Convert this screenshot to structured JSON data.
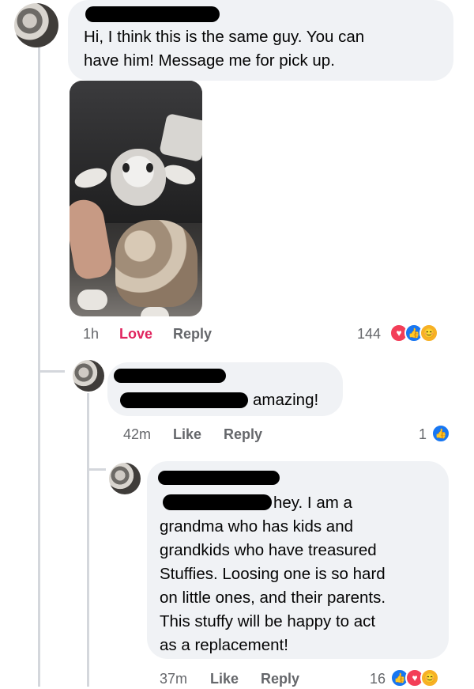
{
  "comment1": {
    "text_lines": [
      "Hi, I think this is the same guy. You can",
      "have him! Message me for pick up."
    ],
    "time": "1h",
    "action_love": "Love",
    "action_reply": "Reply",
    "reaction_count": "144",
    "reaction_icons": [
      "love-reaction",
      "like-reaction",
      "care-reaction"
    ]
  },
  "comment2": {
    "text_suffix": "amazing!",
    "time": "42m",
    "action_like": "Like",
    "action_reply": "Reply",
    "reaction_count": "1",
    "reaction_icons": [
      "like-reaction"
    ]
  },
  "comment3": {
    "line1_suffix": "hey. I am a",
    "text_lines": [
      "grandma who has kids and",
      "grandkids who have treasured",
      "Stuffies. Loosing one is so hard",
      "on little ones, and their parents.",
      "This stuffy will be happy to act",
      "as a replacement!"
    ],
    "time": "37m",
    "action_like": "Like",
    "action_reply": "Reply",
    "reaction_count": "16",
    "reaction_icons": [
      "like-reaction",
      "love-reaction",
      "care-reaction"
    ]
  },
  "colors": {
    "bubble": "#f0f2f5",
    "meta": "#65676b",
    "love_accent": "#e0245e",
    "like": "#1877f2"
  }
}
